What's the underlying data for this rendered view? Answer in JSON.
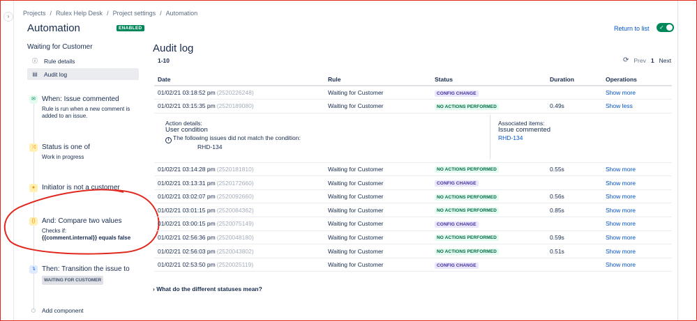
{
  "breadcrumb": [
    "Projects",
    "Rulex Help Desk",
    "Project settings",
    "Automation"
  ],
  "header": {
    "title": "Automation",
    "badge": "ENABLED",
    "return_link": "Return to list",
    "toggle_on": true
  },
  "sidebar": {
    "rule_name": "Waiting for Customer",
    "nav": [
      {
        "label": "Rule details",
        "icon": "info-icon"
      },
      {
        "label": "Audit log",
        "icon": "document-icon",
        "active": true
      }
    ],
    "components": [
      {
        "title": "When: Issue commented",
        "desc1": "Rule is run when a new comment is",
        "desc2": "added to an issue.",
        "icon": "comment-icon",
        "color": "#e3fcef"
      },
      {
        "title": "Status is one of",
        "desc1": "Work in progress",
        "icon": "shuffle-icon",
        "color": "#fff7d6"
      },
      {
        "title": "Initiator is not a customer",
        "icon": "user-icon",
        "color": "#fff7d6"
      },
      {
        "title": "And: Compare two values",
        "desc1": "Checks if:",
        "desc2": "{{comment.internal}} equals false",
        "icon": "braces-icon",
        "color": "#fff7d6"
      },
      {
        "title": "Then: Transition the issue to",
        "badge": "WAITING FOR CUSTOMER",
        "icon": "transition-icon",
        "color": "#deebff"
      }
    ],
    "add_component": "Add component"
  },
  "audit": {
    "title": "Audit log",
    "range": "1-10",
    "pager": {
      "prev": "Prev",
      "page": "1",
      "next": "Next"
    },
    "columns": [
      "Date",
      "Rule",
      "Status",
      "Duration",
      "Operations"
    ],
    "rows": [
      {
        "date": "01/02/21 03:18:52 pm",
        "id": "(2520226248)",
        "rule": "Waiting for Customer",
        "status": "CONFIG CHANGE",
        "kind": "config",
        "duration": "",
        "op": "Show more"
      },
      {
        "date": "01/02/21 03:15:35 pm",
        "id": "(2520189080)",
        "rule": "Waiting for Customer",
        "status": "NO ACTIONS PERFORMED",
        "kind": "noact",
        "duration": "0.49s",
        "op": "Show less"
      },
      {
        "date": "01/02/21 03:14:28 pm",
        "id": "(2520181810)",
        "rule": "Waiting for Customer",
        "status": "NO ACTIONS PERFORMED",
        "kind": "noact",
        "duration": "0.55s",
        "op": "Show more"
      },
      {
        "date": "01/02/21 03:13:31 pm",
        "id": "(2520172660)",
        "rule": "Waiting for Customer",
        "status": "CONFIG CHANGE",
        "kind": "config",
        "duration": "",
        "op": "Show more"
      },
      {
        "date": "01/02/21 03:02:07 pm",
        "id": "(2520092660)",
        "rule": "Waiting for Customer",
        "status": "NO ACTIONS PERFORMED",
        "kind": "noact",
        "duration": "0.56s",
        "op": "Show more"
      },
      {
        "date": "01/02/21 03:01:15 pm",
        "id": "(2520084362)",
        "rule": "Waiting for Customer",
        "status": "NO ACTIONS PERFORMED",
        "kind": "noact",
        "duration": "0.85s",
        "op": "Show more"
      },
      {
        "date": "01/02/21 03:00:15 pm",
        "id": "(2520075149)",
        "rule": "Waiting for Customer",
        "status": "CONFIG CHANGE",
        "kind": "config",
        "duration": "",
        "op": "Show more"
      },
      {
        "date": "01/02/21 02:56:36 pm",
        "id": "(2520048180)",
        "rule": "Waiting for Customer",
        "status": "NO ACTIONS PERFORMED",
        "kind": "noact",
        "duration": "0.59s",
        "op": "Show more"
      },
      {
        "date": "01/02/21 02:56:03 pm",
        "id": "(2520043802)",
        "rule": "Waiting for Customer",
        "status": "NO ACTIONS PERFORMED",
        "kind": "noact",
        "duration": "0.51s",
        "op": "Show more"
      },
      {
        "date": "01/02/21 02:53:50 pm",
        "id": "(2520025119)",
        "rule": "Waiting for Customer",
        "status": "CONFIG CHANGE",
        "kind": "config",
        "duration": "",
        "op": "Show more"
      }
    ],
    "detail": {
      "action_label": "Action details:",
      "action_value": "User condition",
      "message": "The following issues did not match the condition:",
      "issue": "RHD-134",
      "assoc_label": "Associated items:",
      "assoc_value": "Issue commented",
      "assoc_link": "RHD-134"
    },
    "faq": "What do the different statuses mean?"
  },
  "colors": {
    "accent": "#0052cc",
    "enabled": "#00875a",
    "annotation": "#e0281f"
  }
}
